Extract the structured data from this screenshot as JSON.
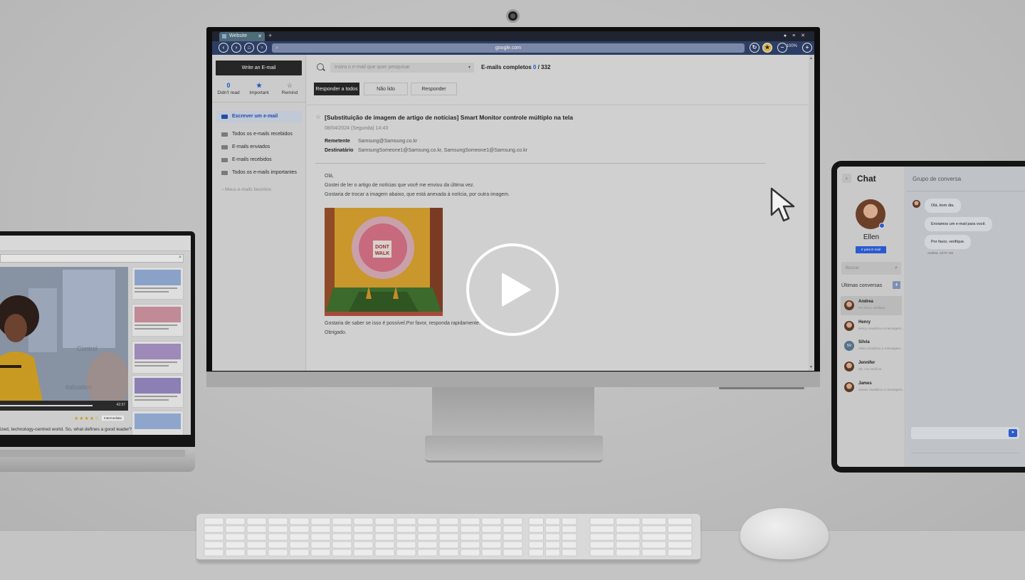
{
  "monitor": {
    "browser": {
      "tab_title": "Website",
      "tab_close": "✕",
      "new_tab": "+",
      "window_controls": "● ≡ ✕",
      "url": "google.com",
      "zoom": "100%"
    },
    "email": {
      "write_button": "Write an E-mail",
      "stats": [
        {
          "value": "0",
          "label": "Didn't read"
        },
        {
          "value": "★",
          "label": "Important"
        },
        {
          "value": "☆",
          "label": "Remind"
        }
      ],
      "folders": [
        "Escrever um e-mail",
        "Todos os e-mails recebidos",
        "E-mails enviados",
        "E-mails recebidos",
        "Todos os e-mails importantes"
      ],
      "favorites_label": "Meus e-mails favoritos",
      "search_placeholder": "Insira o e-mail que quer pesquisar",
      "count_label": "E-mails completos",
      "count_current": "0",
      "count_total": "/ 332",
      "filter_buttons": [
        "Responder a todos",
        "Não lido",
        "Responder"
      ],
      "subject": "[Substituição de imagem de artigo de notícias] Smart Monitor controle múltiplo na tela",
      "date": "08/04/2024 (Segunda) 14:43",
      "sender_label": "Remetente",
      "sender": "Samsung@Samsung.co.kr",
      "recipient_label": "Destinatário",
      "recipient": "SamsungSomeone1@Samsung.co.kr, SamsungSomeone1@Samsung.co.kr",
      "body": [
        "Olá,",
        "Gostei de ler o artigo de notícias que você me enviou da última vez.",
        "Gostaria de trocar a imagem abaixo, que está anexada à notícia, por outra imagem."
      ],
      "photo_sign_line1": "DONT",
      "photo_sign_line2": "WALK",
      "footer": [
        "Gostaria de saber se isso é possível.Por favor, responda rapidamente.",
        "Obrigado."
      ]
    }
  },
  "laptop": {
    "video_texts": [
      "Control",
      "italization"
    ],
    "time": "42:37",
    "rating": "★★★★☆",
    "badge": "Intermediate",
    "caption": "ized, technology-centred world. So, what defines a good leader?",
    "cards": [
      {
        "title": "How to lead Leadership",
        "more": "SEE MORE"
      },
      {
        "title": "Digital Leadership Skills",
        "more": "SEE MORE"
      },
      {
        "title": "Effective Leadership",
        "more": "SEE MORE"
      },
      {
        "title": "The Future of Leadership",
        "more": "SEE MORE"
      },
      {
        "title": "Leadership Basics",
        "more": ""
      }
    ]
  },
  "tablet": {
    "title": "Chat",
    "contact_name": "Ellen",
    "contact_button": "Ir para E-mail",
    "search_placeholder": "Buscar",
    "recent_label": "Últimas conversas",
    "conversations": [
      {
        "initials": "",
        "name": "Andrea",
        "preview": "Por favor, verifique."
      },
      {
        "initials": "",
        "name": "Henry",
        "preview": "Henry visualizou a mensagem..."
      },
      {
        "initials": "SV",
        "name": "Silvia",
        "preview": "Silvia visualizou a mensagem..."
      },
      {
        "initials": "",
        "name": "Jennifer",
        "preview": "Ok, vou verificar."
      },
      {
        "initials": "",
        "name": "James",
        "preview": "James visualizou a mensagem..."
      }
    ],
    "group_title": "Grupo de conversa",
    "messages": [
      "Olá, bom dia.",
      "Enviamos um e-mail para você.",
      "Por favor, verifique."
    ],
    "timestamp": "Andrea, 12:07 AM"
  }
}
